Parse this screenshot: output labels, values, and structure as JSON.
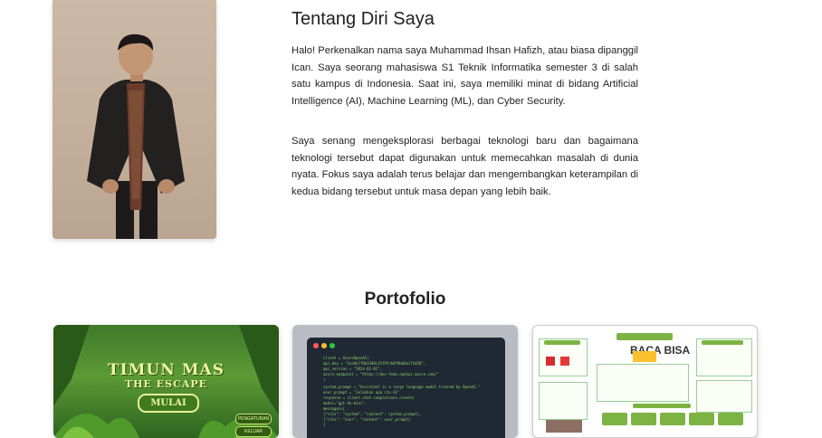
{
  "about": {
    "title": "Tentang Diri Saya",
    "paragraphs": [
      "Halo! Perkenalkan nama saya Muhammad Ihsan Hafizh, atau biasa dipanggil Ican. Saya seorang mahasiswa S1 Teknik Informatika semester 3 di salah satu kampus di Indonesia. Saat ini, saya memiliki minat di bidang Artificial Intelligence (AI), Machine Learning (ML), dan Cyber Security.",
      "Saya senang mengeksplorasi berbagai teknologi baru dan bagaimana teknologi tersebut dapat digunakan untuk memecahkan masalah di dunia nyata. Fokus saya adalah terus belajar dan mengembangkan keterampilan di kedua bidang tersebut untuk masa depan yang lebih baik."
    ]
  },
  "portfolio": {
    "title": "Portofolio",
    "items": [
      {
        "game_title": "TIMUN MAS",
        "game_subtitle": "THE ESCAPE",
        "start_button": "MULAI",
        "side_buttons": [
          "PENGATURAN",
          "KELUAR"
        ]
      },
      {
        "code_lines": [
          "client = AzureOpenAI(",
          "    api_key = \"3ce8e7f0b3340c21f9fcb8f9bb6a1f3d20\",",
          "    api_version = \"2024-02-01\",",
          "    azure_endpoint = \"https://dev-fedo.openai.azure.com/\"",
          ")",
          "system_prompt = \"Assistant is a large language model trained by OpenAI.\"",
          "user_prompt = \"Jelaskan apa itu AI\"",
          "response = client.chat.completions.create(",
          "    model=\"gpt-4o-mini\",",
          "    messages=[",
          "        {\"role\": \"system\", \"content\": system_prompt},",
          "        {\"role\": \"user\", \"content\": user_prompt}",
          "    ]"
        ]
      },
      {
        "poster_title": "BACA BISA"
      }
    ]
  },
  "colors": {
    "text": "#222222",
    "game_green": "#3f7a2a",
    "code_bg": "#1f2833",
    "poster_green": "#7cb342"
  }
}
